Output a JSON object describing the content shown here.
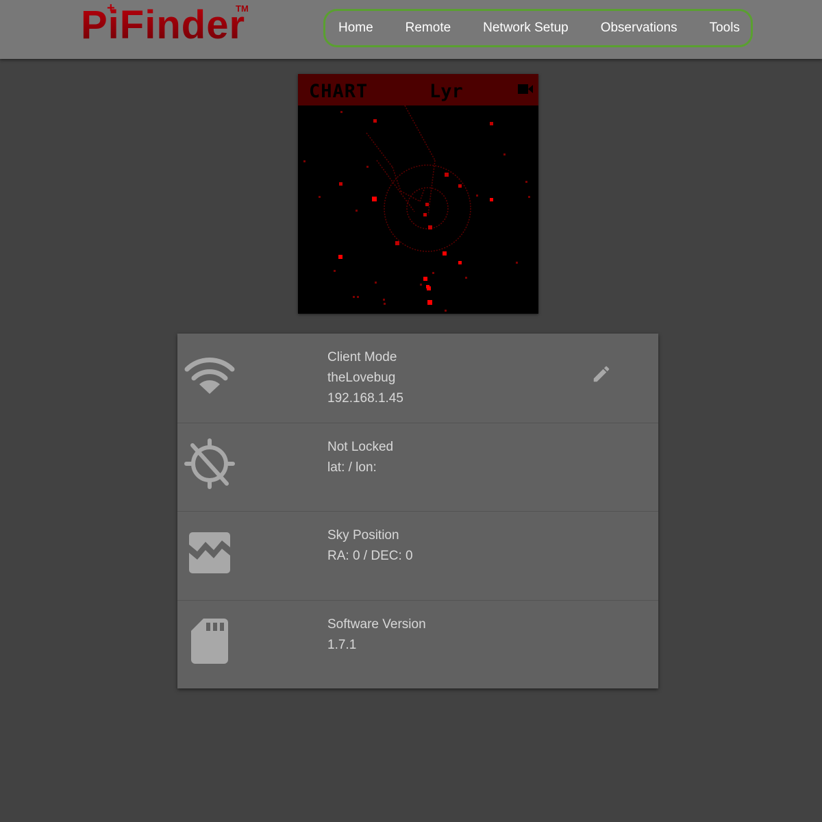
{
  "brand": {
    "name": "PiFinder",
    "tm": "TM",
    "accent": "#b3000a"
  },
  "nav": {
    "items": [
      {
        "label": "Home"
      },
      {
        "label": "Remote"
      },
      {
        "label": "Network Setup"
      },
      {
        "label": "Observations"
      },
      {
        "label": "Tools"
      }
    ],
    "border_color": "#5aa030"
  },
  "screen": {
    "mode": "CHART",
    "constellation": "Lyr",
    "header_color": "#4c0000",
    "icon": "camera-icon"
  },
  "status": {
    "network": {
      "icon": "wifi-icon",
      "mode": "Client Mode",
      "ssid": "theLovebug",
      "ip": "192.168.1.45",
      "action_icon": "pencil-icon"
    },
    "gps": {
      "icon": "gps-off-icon",
      "state": "Not Locked",
      "coords": "lat: / lon:"
    },
    "sky": {
      "icon": "image-icon",
      "title": "Sky Position",
      "coords": "RA: 0 / DEC: 0"
    },
    "software": {
      "icon": "sd-card-icon",
      "title": "Software Version",
      "version": "1.7.1"
    }
  },
  "colors": {
    "page_bg": "#424242",
    "topbar_bg": "#787878",
    "card_bg": "#616161",
    "icon_color": "#a8a8a8",
    "star_red": "#ff0000",
    "line_red": "#5a0000"
  }
}
